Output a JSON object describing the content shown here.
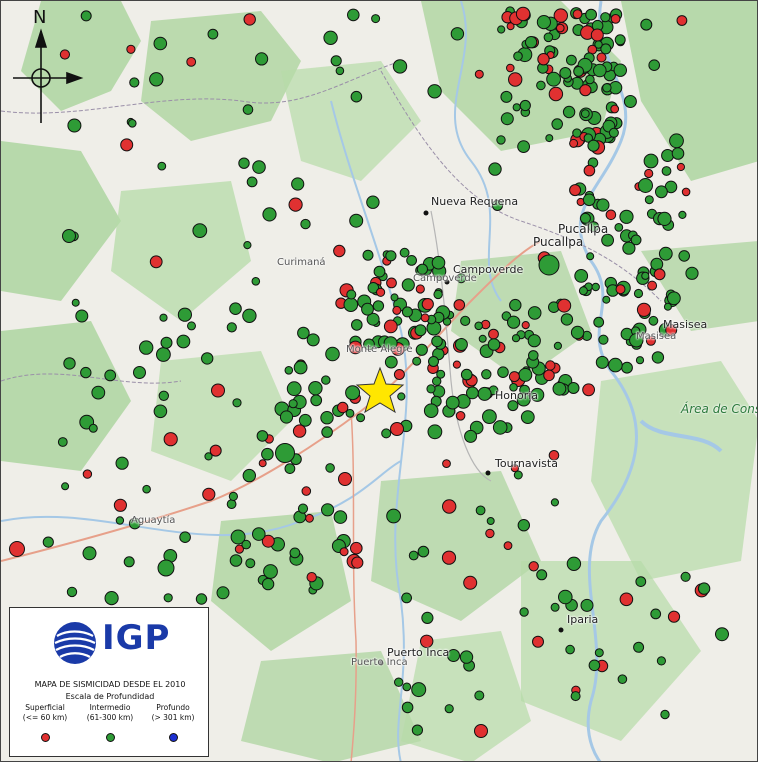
{
  "map": {
    "north_label": "N",
    "colors": {
      "superficial": "#e03131",
      "intermedio": "#2e9b36",
      "profundo": "#1c2fd0",
      "epicenter": "#ffe600"
    },
    "places": [
      {
        "name": "Nueva Requena",
        "kind": "town"
      },
      {
        "name": "Pucallpa",
        "kind": "city"
      },
      {
        "name": "Campoverde",
        "kind": "town"
      },
      {
        "name": "Curimaná",
        "kind": "town"
      },
      {
        "name": "Masisea",
        "kind": "town"
      },
      {
        "name": "Monte Alegre",
        "kind": "town"
      },
      {
        "name": "Honoria",
        "kind": "town"
      },
      {
        "name": "Tournavista",
        "kind": "town"
      },
      {
        "name": "Aguaytía",
        "kind": "town"
      },
      {
        "name": "Iparia",
        "kind": "town"
      },
      {
        "name": "Puerto Inca",
        "kind": "town"
      },
      {
        "name": "Área de Conservación Regional Imiría",
        "kind": "protected-area"
      }
    ]
  },
  "legend": {
    "logo": "IGP",
    "title": "MAPA DE SISMICIDAD DESDE EL 2010",
    "subtitle": "Escala de Profundidad",
    "categories": [
      {
        "label": "Superficial",
        "range": "(<= 60 km)",
        "color": "#e03131"
      },
      {
        "label": "Intermedio",
        "range": "(61-300 km)",
        "color": "#2e9b36"
      },
      {
        "label": "Profundo",
        "range": "(> 301 km)",
        "color": "#1c2fd0"
      }
    ]
  }
}
